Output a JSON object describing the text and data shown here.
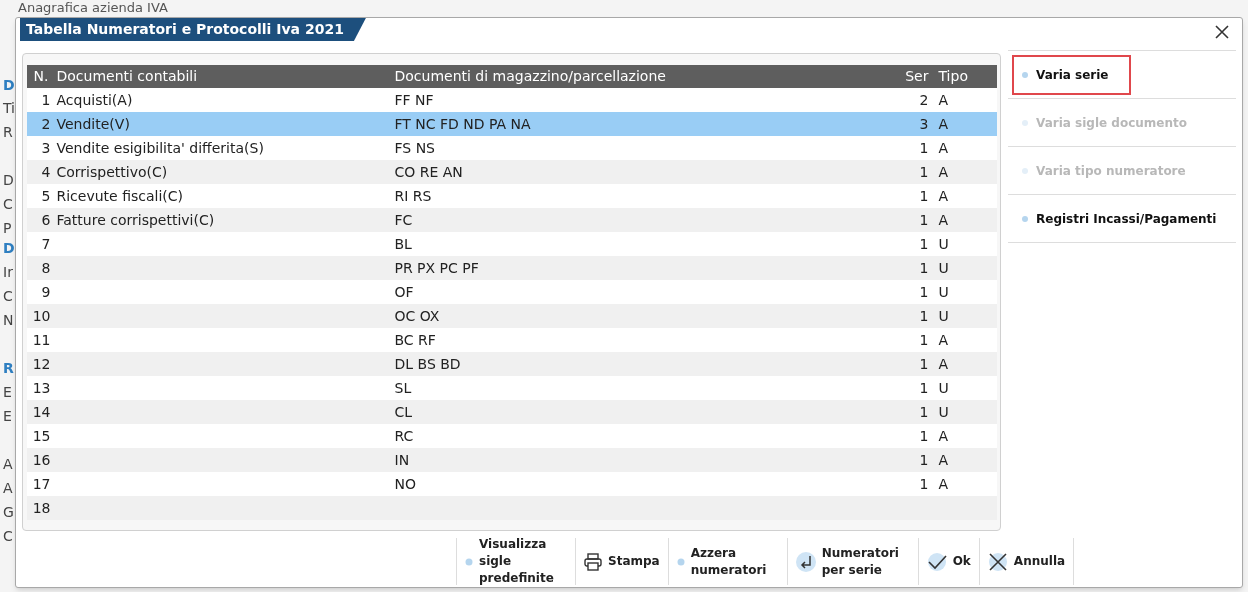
{
  "background_window": {
    "title": "Anagrafica azienda IVA",
    "left_labels": [
      {
        "text": "D",
        "kind": "heading"
      },
      {
        "text": "Ti",
        "kind": "label"
      },
      {
        "text": "R",
        "kind": "label"
      },
      {
        "text": "D",
        "kind": "label"
      },
      {
        "text": "C",
        "kind": "label"
      },
      {
        "text": "P",
        "kind": "label"
      },
      {
        "text": "D",
        "kind": "heading"
      },
      {
        "text": "Ir",
        "kind": "label"
      },
      {
        "text": "C",
        "kind": "label"
      },
      {
        "text": "N",
        "kind": "label"
      },
      {
        "text": "R",
        "kind": "heading"
      },
      {
        "text": "E",
        "kind": "label"
      },
      {
        "text": "E",
        "kind": "label"
      },
      {
        "text": "A",
        "kind": "label"
      },
      {
        "text": "A",
        "kind": "label"
      },
      {
        "text": "G",
        "kind": "label"
      },
      {
        "text": "C",
        "kind": "label"
      }
    ]
  },
  "dialog": {
    "title": "Tabella Numeratori e Protocolli Iva 2021",
    "table": {
      "columns": [
        "N.",
        "Documenti contabili",
        "Documenti di magazzino/parcellazione",
        "Ser",
        "Tipo"
      ],
      "rows": [
        {
          "n": "1",
          "contabili": "Acquisti(A)",
          "magazzino": "FF NF",
          "ser": "2",
          "tipo": "A",
          "selected": false
        },
        {
          "n": "2",
          "contabili": "Vendite(V)",
          "magazzino": "FT NC FD ND PA NA",
          "ser": "3",
          "tipo": "A",
          "selected": true
        },
        {
          "n": "3",
          "contabili": "Vendite esigibilita' differita(S)",
          "magazzino": "FS NS",
          "ser": "1",
          "tipo": "A",
          "selected": false
        },
        {
          "n": "4",
          "contabili": "Corrispettivo(C)",
          "magazzino": "CO RE AN",
          "ser": "1",
          "tipo": "A",
          "selected": false
        },
        {
          "n": "5",
          "contabili": "Ricevute fiscali(C)",
          "magazzino": "RI RS",
          "ser": "1",
          "tipo": "A",
          "selected": false
        },
        {
          "n": "6",
          "contabili": "Fatture corrispettivi(C)",
          "magazzino": "FC",
          "ser": "1",
          "tipo": "A",
          "selected": false
        },
        {
          "n": "7",
          "magazzino": "BL",
          "ser": "1",
          "tipo": "U",
          "selected": false
        },
        {
          "n": "8",
          "magazzino": "PR PX PC PF",
          "ser": "1",
          "tipo": "U",
          "selected": false
        },
        {
          "n": "9",
          "magazzino": "OF",
          "ser": "1",
          "tipo": "U",
          "selected": false
        },
        {
          "n": "10",
          "magazzino": "OC OX",
          "ser": "1",
          "tipo": "U",
          "selected": false
        },
        {
          "n": "11",
          "magazzino": "BC RF",
          "ser": "1",
          "tipo": "A",
          "selected": false
        },
        {
          "n": "12",
          "magazzino": "DL BS BD",
          "ser": "1",
          "tipo": "A",
          "selected": false
        },
        {
          "n": "13",
          "magazzino": "SL",
          "ser": "1",
          "tipo": "U",
          "selected": false
        },
        {
          "n": "14",
          "magazzino": "CL",
          "ser": "1",
          "tipo": "U",
          "selected": false
        },
        {
          "n": "15",
          "magazzino": "RC",
          "ser": "1",
          "tipo": "A",
          "selected": false
        },
        {
          "n": "16",
          "magazzino": "IN",
          "ser": "1",
          "tipo": "A",
          "selected": false
        },
        {
          "n": "17",
          "magazzino": "NO",
          "ser": "1",
          "tipo": "A",
          "selected": false
        },
        {
          "n": "18",
          "selected": false
        }
      ]
    },
    "side_actions": [
      {
        "label": "Varia serie",
        "disabled": false,
        "highlighted": true
      },
      {
        "label": "Varia sigle documento",
        "disabled": true,
        "highlighted": false
      },
      {
        "label": "Varia tipo numeratore",
        "disabled": true,
        "highlighted": false
      },
      {
        "label": "Registri Incassi/Pagamenti",
        "disabled": false,
        "highlighted": false
      }
    ],
    "buttons": [
      {
        "label": "Visualizza sigle predefinite",
        "kind": "dot"
      },
      {
        "label": "Stampa",
        "kind": "print"
      },
      {
        "label": "Azzera numeratori",
        "kind": "dot"
      },
      {
        "label": "Numeratori per serie",
        "kind": "enter"
      },
      {
        "label": "Ok",
        "kind": "check"
      },
      {
        "label": "Annulla",
        "kind": "cross"
      }
    ]
  }
}
